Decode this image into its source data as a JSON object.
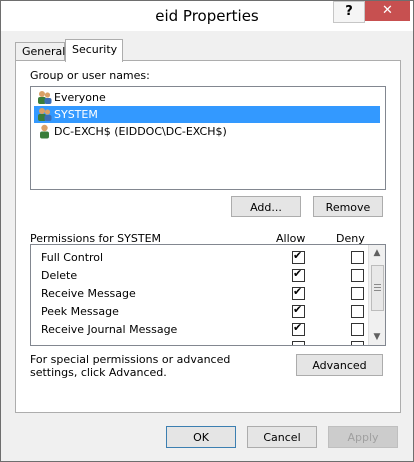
{
  "window": {
    "title": "eid Properties",
    "help_label": "?",
    "close_label": "✕"
  },
  "tabs": [
    {
      "label": "General",
      "selected": false
    },
    {
      "label": "Security",
      "selected": true
    }
  ],
  "security": {
    "group_label": "Group or user names:",
    "users": [
      {
        "name": "Everyone",
        "icon": "group-users-icon",
        "selected": false
      },
      {
        "name": "SYSTEM",
        "icon": "group-users-icon",
        "selected": true
      },
      {
        "name": "DC-EXCH$ (EIDDOC\\DC-EXCH$)",
        "icon": "user-icon",
        "selected": false
      }
    ],
    "add_label": "Add...",
    "remove_label": "Remove",
    "permissions_label": "Permissions for SYSTEM",
    "allow_header": "Allow",
    "deny_header": "Deny",
    "permissions": [
      {
        "name": "Full Control",
        "allow": true,
        "deny": false
      },
      {
        "name": "Delete",
        "allow": true,
        "deny": false
      },
      {
        "name": "Receive Message",
        "allow": true,
        "deny": false
      },
      {
        "name": "Peek Message",
        "allow": true,
        "deny": false
      },
      {
        "name": "Receive Journal Message",
        "allow": true,
        "deny": false
      }
    ],
    "advanced_text": "For special permissions or advanced settings, click Advanced.",
    "advanced_label": "Advanced"
  },
  "footer": {
    "ok_label": "OK",
    "cancel_label": "Cancel",
    "apply_label": "Apply"
  },
  "colors": {
    "selection": "#3399ff",
    "close": "#c75050"
  }
}
